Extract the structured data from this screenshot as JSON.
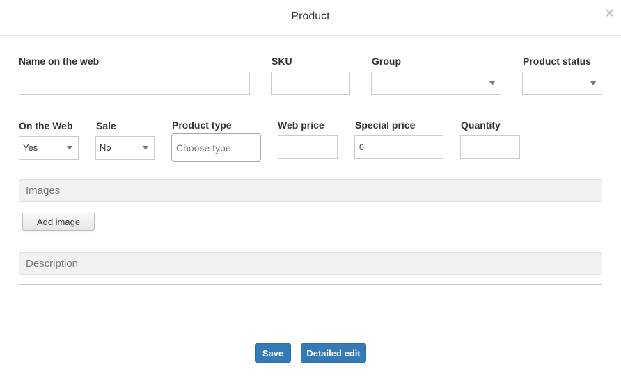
{
  "dialog": {
    "title": "Product",
    "close_glyph": "×"
  },
  "fields": {
    "name_on_web": {
      "label": "Name on the web",
      "value": ""
    },
    "sku": {
      "label": "SKU",
      "value": ""
    },
    "group": {
      "label": "Group",
      "value": ""
    },
    "product_status": {
      "label": "Product status",
      "value": ""
    },
    "on_the_web": {
      "label": "On the Web",
      "value": "Yes"
    },
    "sale": {
      "label": "Sale",
      "value": "No"
    },
    "product_type": {
      "label": "Product type",
      "placeholder": "Choose type"
    },
    "web_price": {
      "label": "Web price",
      "value": ""
    },
    "special_price": {
      "label": "Special price",
      "value": "0"
    },
    "quantity": {
      "label": "Quantity",
      "value": ""
    }
  },
  "sections": {
    "images": {
      "title": "Images",
      "add_button": "Add image"
    },
    "description": {
      "title": "Description",
      "value": ""
    }
  },
  "footer": {
    "save_label": "Save",
    "detailed_edit_label": "Detailed edit"
  },
  "colors": {
    "primary": "#337ab7",
    "section_bg": "#f2f2f2",
    "border": "#cccccc"
  },
  "icons": {
    "close": "close-icon",
    "dropdown": "chevron-down-icon"
  }
}
